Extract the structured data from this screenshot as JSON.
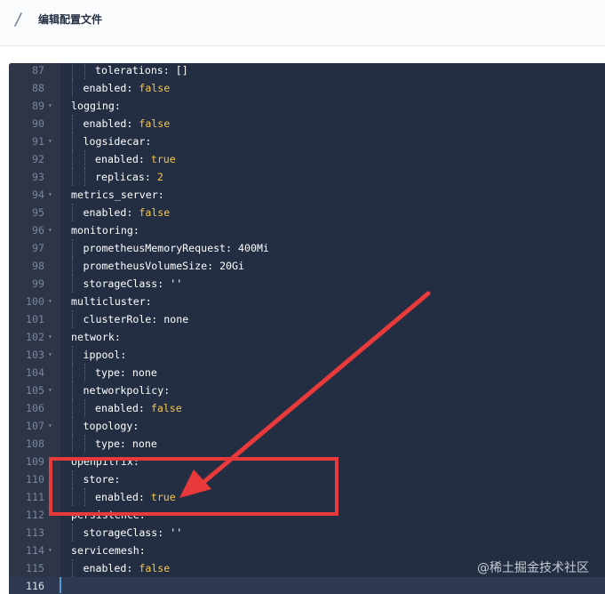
{
  "header": {
    "title": "编辑配置文件",
    "icon": "pen-icon"
  },
  "editor": {
    "lines": [
      {
        "num": "87",
        "fold": false,
        "indent": 2,
        "key": "tolerations",
        "sep": ": ",
        "val": "[]",
        "vtype": "v"
      },
      {
        "num": "88",
        "fold": false,
        "indent": 1,
        "key": "enabled",
        "sep": ": ",
        "val": "false",
        "vtype": "b"
      },
      {
        "num": "89",
        "fold": true,
        "indent": 0,
        "key": "logging",
        "sep": ":",
        "val": "",
        "vtype": "v"
      },
      {
        "num": "90",
        "fold": false,
        "indent": 1,
        "key": "enabled",
        "sep": ": ",
        "val": "false",
        "vtype": "b"
      },
      {
        "num": "91",
        "fold": true,
        "indent": 1,
        "key": "logsidecar",
        "sep": ":",
        "val": "",
        "vtype": "v"
      },
      {
        "num": "92",
        "fold": false,
        "indent": 2,
        "key": "enabled",
        "sep": ": ",
        "val": "true",
        "vtype": "b"
      },
      {
        "num": "93",
        "fold": false,
        "indent": 2,
        "key": "replicas",
        "sep": ": ",
        "val": "2",
        "vtype": "n"
      },
      {
        "num": "94",
        "fold": true,
        "indent": 0,
        "key": "metrics_server",
        "sep": ":",
        "val": "",
        "vtype": "v"
      },
      {
        "num": "95",
        "fold": false,
        "indent": 1,
        "key": "enabled",
        "sep": ": ",
        "val": "false",
        "vtype": "b"
      },
      {
        "num": "96",
        "fold": true,
        "indent": 0,
        "key": "monitoring",
        "sep": ":",
        "val": "",
        "vtype": "v"
      },
      {
        "num": "97",
        "fold": false,
        "indent": 1,
        "key": "prometheusMemoryRequest",
        "sep": ": ",
        "val": "400Mi",
        "vtype": "v"
      },
      {
        "num": "98",
        "fold": false,
        "indent": 1,
        "key": "prometheusVolumeSize",
        "sep": ": ",
        "val": "20Gi",
        "vtype": "v"
      },
      {
        "num": "99",
        "fold": false,
        "indent": 1,
        "key": "storageClass",
        "sep": ": ",
        "val": "''",
        "vtype": "v"
      },
      {
        "num": "100",
        "fold": true,
        "indent": 0,
        "key": "multicluster",
        "sep": ":",
        "val": "",
        "vtype": "v"
      },
      {
        "num": "101",
        "fold": false,
        "indent": 1,
        "key": "clusterRole",
        "sep": ": ",
        "val": "none",
        "vtype": "v"
      },
      {
        "num": "102",
        "fold": true,
        "indent": 0,
        "key": "network",
        "sep": ":",
        "val": "",
        "vtype": "v"
      },
      {
        "num": "103",
        "fold": true,
        "indent": 1,
        "key": "ippool",
        "sep": ":",
        "val": "",
        "vtype": "v"
      },
      {
        "num": "104",
        "fold": false,
        "indent": 2,
        "key": "type",
        "sep": ": ",
        "val": "none",
        "vtype": "v"
      },
      {
        "num": "105",
        "fold": true,
        "indent": 1,
        "key": "networkpolicy",
        "sep": ":",
        "val": "",
        "vtype": "v"
      },
      {
        "num": "106",
        "fold": false,
        "indent": 2,
        "key": "enabled",
        "sep": ": ",
        "val": "false",
        "vtype": "b"
      },
      {
        "num": "107",
        "fold": true,
        "indent": 1,
        "key": "topology",
        "sep": ":",
        "val": "",
        "vtype": "v"
      },
      {
        "num": "108",
        "fold": false,
        "indent": 2,
        "key": "type",
        "sep": ": ",
        "val": "none",
        "vtype": "v"
      },
      {
        "num": "109",
        "fold": true,
        "indent": 0,
        "key": "openpitrix",
        "sep": ":",
        "val": "",
        "vtype": "v"
      },
      {
        "num": "110",
        "fold": true,
        "indent": 1,
        "key": "store",
        "sep": ":",
        "val": "",
        "vtype": "v"
      },
      {
        "num": "111",
        "fold": false,
        "indent": 2,
        "key": "enabled",
        "sep": ": ",
        "val": "true",
        "vtype": "b"
      },
      {
        "num": "112",
        "fold": true,
        "indent": 0,
        "key": "persistence",
        "sep": ":",
        "val": "",
        "vtype": "v"
      },
      {
        "num": "113",
        "fold": false,
        "indent": 1,
        "key": "storageClass",
        "sep": ": ",
        "val": "''",
        "vtype": "v"
      },
      {
        "num": "114",
        "fold": true,
        "indent": 0,
        "key": "servicemesh",
        "sep": ":",
        "val": "",
        "vtype": "v"
      },
      {
        "num": "115",
        "fold": false,
        "indent": 1,
        "key": "enabled",
        "sep": ": ",
        "val": "false",
        "vtype": "b"
      },
      {
        "num": "116",
        "fold": false,
        "indent": 0,
        "key": "",
        "sep": "",
        "val": "",
        "vtype": "v",
        "active": true
      }
    ]
  },
  "annotation": {
    "box_color": "#e83a3a",
    "arrow_color": "#e83a3a"
  },
  "watermark": "@稀土掘金技术社区",
  "colors": {
    "editor_bg": "#242e42",
    "gutter_bg": "#2d3547",
    "bool": "#f5c449"
  }
}
